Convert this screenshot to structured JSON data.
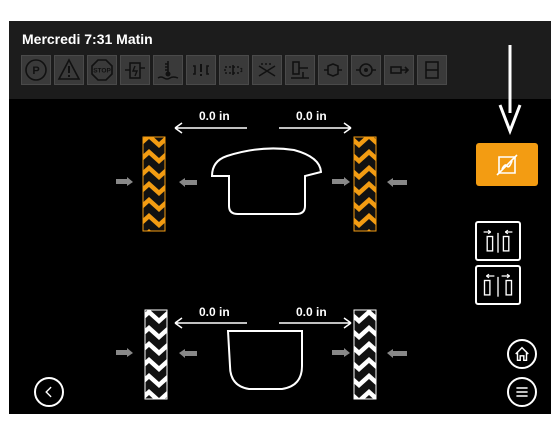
{
  "header": {
    "datetime": "Mercredi 7:31 Matin",
    "icons": [
      "parking-brake-icon",
      "warning-triangle-icon",
      "stop-icon",
      "fuel-filter-icon",
      "coolant-level-icon",
      "engine-check-icon",
      "engine-fault-icon",
      "engine-off-icon",
      "hydraulic-oil-icon",
      "transmission-icon",
      "oil-pressure-icon",
      "transmission-filter-icon",
      "partial-icon"
    ]
  },
  "front": {
    "left_value": "0.0 in",
    "right_value": "0.0 in"
  },
  "rear": {
    "left_value": "0.0 in",
    "right_value": "0.0 in"
  },
  "colors": {
    "accent": "#f39c12",
    "tile": "#3a3a3a",
    "background": "#000000"
  }
}
